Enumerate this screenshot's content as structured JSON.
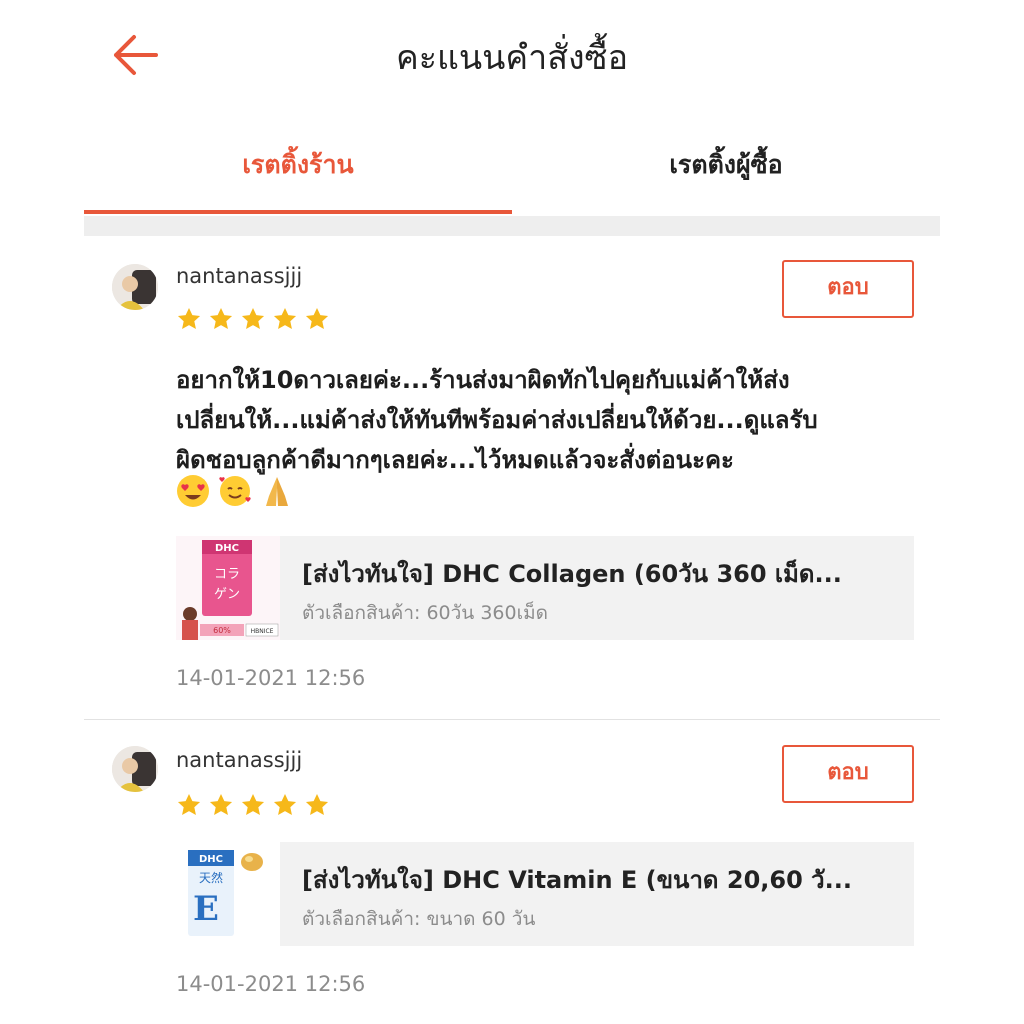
{
  "header": {
    "title": "คะแนนคำสั่งซื้อ",
    "back_icon": "arrow-left-icon",
    "accent": "#e8573a"
  },
  "tabs": [
    {
      "label": "เรตติ้งร้าน",
      "active": true
    },
    {
      "label": "เรตติ้งผู้ซื้อ",
      "active": false
    }
  ],
  "reviews": [
    {
      "username": "nantanassjjj",
      "rating": 5,
      "reply_label": "ตอบ",
      "text_lines": [
        "อยากให้10ดาวเลยค่ะ...ร้านส่งมาผิดทักไปคุยกับแม่ค้าให้ส่ง",
        "เปลี่ยนให้...แม่ค้าส่งให้ทันทีพร้อมค่าส่งเปลี่ยนให้ด้วย...ดูแลรับ",
        "ผิดชอบลูกค้าดีมากๆเลยค่ะ...ไว้หมดแล้วจะสั่งต่อนะคะ"
      ],
      "emojis": [
        "heart-eyes-emoji",
        "smiling-face-with-hearts-emoji",
        "folded-hands-emoji"
      ],
      "product": {
        "title": "[ส่งไวทันใจ] DHC Collagen (60วัน 360 เม็ด...",
        "option": "ตัวเลือกสินค้า: 60วัน 360เม็ด",
        "thumb_text": [
          "DHC",
          "コラ",
          "ゲン",
          "60%",
          "HBNICE"
        ]
      },
      "date": "14-01-2021 12:56"
    },
    {
      "username": "nantanassjjj",
      "rating": 5,
      "reply_label": "ตอบ",
      "product": {
        "title": "[ส่งไวทันใจ] DHC Vitamin E (ขนาด 20,60 วั...",
        "option": "ตัวเลือกสินค้า: ขนาด 60 วัน",
        "thumb_text": [
          "DHC",
          "天然",
          "E"
        ]
      },
      "date": "14-01-2021 12:56"
    }
  ]
}
